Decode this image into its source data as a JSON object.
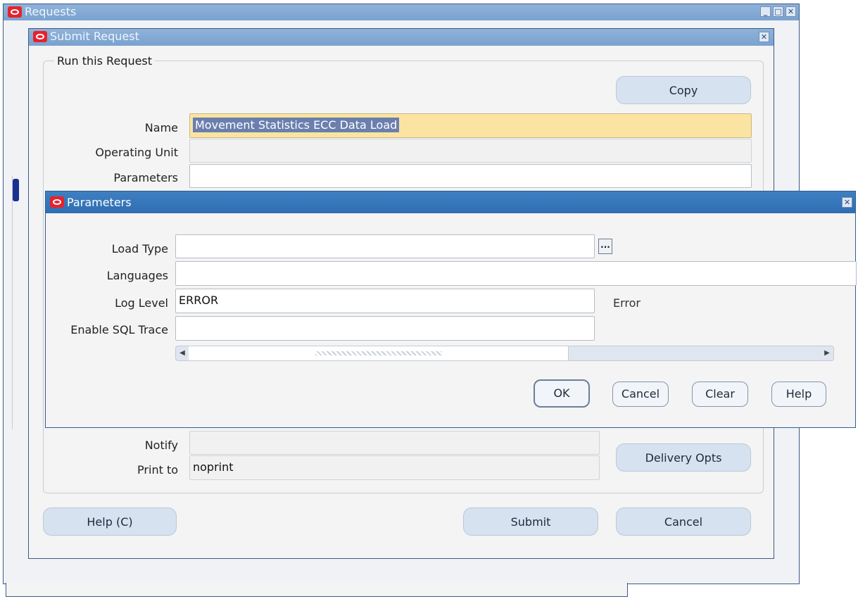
{
  "requests_window": {
    "title": "Requests"
  },
  "submit_window": {
    "title": "Submit Request",
    "group_legend": "Run this Request",
    "copy_label": "Copy",
    "name_label": "Name",
    "name_value": "Movement Statistics ECC Data Load",
    "operating_unit_label": "Operating Unit",
    "operating_unit_value": "",
    "parameters_label": "Parameters",
    "parameters_value": "",
    "notify_label": "Notify",
    "notify_value": "",
    "print_to_label": "Print to",
    "print_to_value": "noprint",
    "delivery_opts_label": "Delivery Opts",
    "help_label": "Help (C)",
    "submit_label": "Submit",
    "cancel_label": "Cancel"
  },
  "parameters_window": {
    "title": "Parameters",
    "load_type_label": "Load Type",
    "load_type_value": "",
    "languages_label": "Languages",
    "languages_value": "",
    "log_level_label": "Log Level",
    "log_level_value": "ERROR",
    "log_level_description": "Error",
    "sql_trace_label": "Enable SQL Trace",
    "sql_trace_value": "",
    "lov_button_glyph": "...",
    "ok_label": "OK",
    "cancel_label": "Cancel",
    "clear_label": "Clear",
    "help_label": "Help"
  },
  "colors": {
    "active_title": "#2f6eb1",
    "inactive_title": "#8fb2d9",
    "name_field": "#fbe4a2",
    "brand": "#e8222a"
  },
  "icons": [
    "oracle-logo-icon",
    "minimize-icon",
    "maximize-icon",
    "close-icon",
    "lov-ellipsis-icon",
    "scroll-left-icon",
    "scroll-right-icon"
  ]
}
